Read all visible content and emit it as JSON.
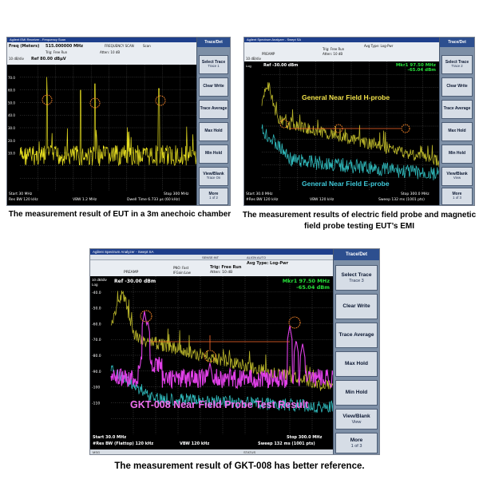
{
  "panel1": {
    "titlebar": "Agilent EMI Receiver - Frequency Scan",
    "freq_label": "Freq (Meters)",
    "freq_value": "515.000000 MHz",
    "scan_mode": "FREQUENCY SCAN",
    "scan_label": "Scan",
    "trig": "Trig: Free Run",
    "atten": "Atten: 10 dB",
    "scale": "10 dB/div",
    "ref": "Ref 80.00 dBµV",
    "start": "Start 30 MHz",
    "stop": "Stop 300 MHz",
    "res_bw": "Res BW 120 kHz",
    "vbw": "VBW 1.2 MHz",
    "dwell": "Dwell Time 6.733 µs (60 kHz)",
    "y_ticks": [
      "70.0",
      "60.0",
      "50.0",
      "40.0",
      "30.0",
      "20.0",
      "10.0"
    ],
    "softkeys": {
      "header": "Trace/Det",
      "items": [
        {
          "label": "Select Trace",
          "sub": "Trace 1"
        },
        {
          "label": "Clear Write",
          "sub": ""
        },
        {
          "label": "Trace Average",
          "sub": ""
        },
        {
          "label": "Max Hold",
          "sub": ""
        },
        {
          "label": "Min Hold",
          "sub": ""
        },
        {
          "label": "View/Blank",
          "sub": "Trace On"
        },
        {
          "label": "More",
          "sub": "1 of 2"
        }
      ]
    },
    "caption": "The measurement result of EUT in a 3m anechoic chamber"
  },
  "panel2": {
    "titlebar": "Agilent Spectrum Analyzer - Swept SA",
    "avg_type": "Avg Type: Log-Pwr",
    "preamp": "PREAMP",
    "trig": "Trig: Free Run",
    "atten": "Atten: 10 dB",
    "scale": "10 dB/div",
    "ref": "Ref -30.00 dBm",
    "log": "Log",
    "marker_freq": "Mkr1 97.50 MHz",
    "marker_level": "-65.04 dBm",
    "hprobe_label": "General Near Field  H-probe",
    "eprobe_label": "General Near Field  E-probe",
    "start": "Start 30.0 MHz",
    "stop": "Stop 300.0 MHz",
    "res_bw": "#Res BW 120 kHz",
    "vbw": "VBW 120 kHz",
    "sweep": "Sweep  132 ms (1001 pts)",
    "softkeys": {
      "header": "Trace/Det",
      "items": [
        {
          "label": "Select Trace",
          "sub": "Trace 2"
        },
        {
          "label": "Clear Write",
          "sub": ""
        },
        {
          "label": "Trace Average",
          "sub": ""
        },
        {
          "label": "Max Hold",
          "sub": ""
        },
        {
          "label": "Min Hold",
          "sub": ""
        },
        {
          "label": "View/Blank",
          "sub": "View"
        },
        {
          "label": "More",
          "sub": "1 of 3"
        }
      ]
    },
    "caption": "The measurement results of electric field probe and magnetic field probe testing EUT’s EMI"
  },
  "panel3": {
    "titlebar": "Agilent Spectrum Analyzer - Swept SA",
    "sense": "SENSE:INT",
    "align": "ALIGN AUTO",
    "avg_type": "Avg Type: Log-Pwr",
    "pno": "PNO: Fast",
    "ifgain": "IFGain:Low",
    "trig": "Trig: Free Run",
    "atten": "Atten: 10 dB",
    "preamp": "PREAMP",
    "scale": "10 dB/div",
    "log": "Log",
    "ref": "Ref -30.00 dBm",
    "marker_freq": "Mkr1 97.50 MHz",
    "marker_level": "-65.04 dBm",
    "y_ticks": [
      "-40.0",
      "-50.0",
      "-60.0",
      "-70.0",
      "-80.0",
      "-90.0",
      "-100",
      "-110"
    ],
    "result_label": "GKT-008 Near Field Probe Test Result",
    "start": "Start 30.0 MHz",
    "stop": "Stop 300.0 MHz",
    "res_bw": "#Res BW (Flattop) 120 kHz",
    "vbw": "VBW 120 kHz",
    "sweep": "Sweep  132 ms (1001 pts)",
    "msg": "MSG",
    "status": "STATUS",
    "softkeys": {
      "header": "Trace/Det",
      "items": [
        {
          "label": "Select Trace",
          "sub": "Trace 3"
        },
        {
          "label": "Clear Write",
          "sub": ""
        },
        {
          "label": "Trace Average",
          "sub": ""
        },
        {
          "label": "Max Hold",
          "sub": ""
        },
        {
          "label": "Min Hold",
          "sub": ""
        },
        {
          "label": "View/Blank",
          "sub": "View"
        },
        {
          "label": "More",
          "sub": "1 of 3"
        }
      ]
    },
    "caption": "The measurement result of GKT-008 has better reference."
  },
  "colors": {
    "trace_yellow": "#e8e020",
    "trace_yellow_dim": "#b9b52a",
    "trace_cyan": "#2fb7b9",
    "trace_magenta": "#e040e8",
    "marker_green": "#27e03a",
    "circle_orange": "#ff8a2a",
    "label_yellow": "#f2e24a",
    "label_cyan": "#3ec8d8",
    "label_magenta": "#f070f0"
  }
}
